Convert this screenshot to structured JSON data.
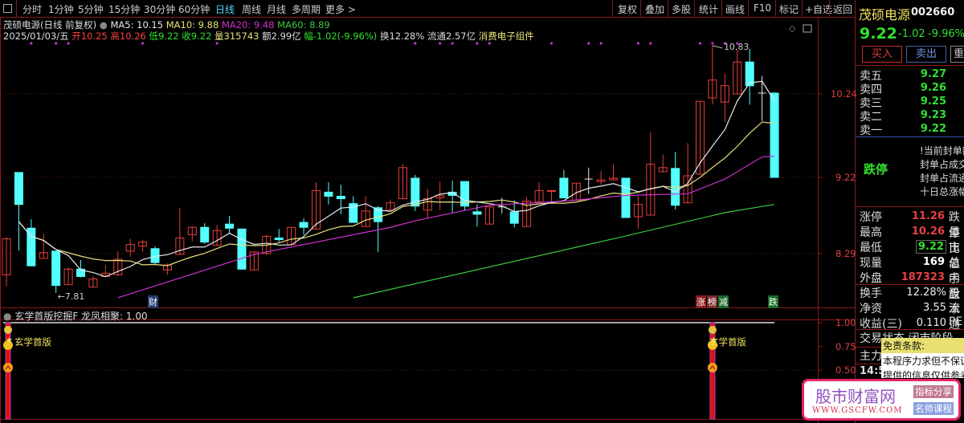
{
  "toolbar": {
    "left": [
      "分时",
      "1分钟",
      "5分钟",
      "15分钟",
      "30分钟",
      "60分钟",
      "日线",
      "周线",
      "月线",
      "多周期",
      "更多 >"
    ],
    "active": "日线",
    "right": [
      "复权",
      "叠加",
      "多股",
      "统计",
      "画线",
      "F10",
      "标记",
      "+自选",
      "返回"
    ]
  },
  "info": {
    "name": "茂硕电源(日线 前复权)",
    "ma5": "MA5: 10.15",
    "ma10": "MA10: 9.88",
    "ma20": "MA20: 9.48",
    "ma60": "MA60: 8.89",
    "date": "2025/01/03/五",
    "open": "开10.25",
    "high": "高10.26",
    "low": "低9.22",
    "close": "收9.22",
    "vol": "量315743",
    "amount": "额2.99亿",
    "change": "幅-1.02(-9.96%)",
    "turnover": "换12.28%",
    "float": "流通2.57亿",
    "sector": "消费电子组件"
  },
  "axis": {
    "main": [
      "10.24",
      "9.22",
      "8.29"
    ],
    "sub": [
      "1.00",
      "0.75",
      "0.50"
    ]
  },
  "chart_tags": {
    "cai": "财",
    "zhang": "涨",
    "bang": "榜",
    "jian": "减",
    "die": "跌"
  },
  "sub_panel": {
    "title": "玄学首版挖掘F",
    "param": "龙凤相聚: 1.00",
    "signal_label": "玄学首版"
  },
  "chart_data": {
    "type": "candlestick",
    "ylim": [
      7.7,
      10.9
    ],
    "candles_ohlc": [
      [
        8.03,
        8.49,
        7.89,
        8.47
      ],
      [
        9.28,
        9.28,
        8.33,
        8.89
      ],
      [
        8.6,
        8.71,
        8.14,
        8.14
      ],
      [
        8.23,
        8.53,
        8.23,
        8.3
      ],
      [
        8.32,
        8.32,
        7.81,
        7.9
      ],
      [
        7.91,
        8.12,
        7.91,
        8.1
      ],
      [
        8.1,
        8.21,
        8.0,
        8.01
      ],
      [
        7.88,
        8.01,
        7.88,
        7.98
      ],
      [
        8.01,
        8.15,
        8.0,
        8.05
      ],
      [
        8.03,
        8.32,
        8.02,
        8.22
      ],
      [
        8.32,
        8.47,
        8.25,
        8.4
      ],
      [
        8.38,
        8.46,
        8.31,
        8.43
      ],
      [
        8.35,
        8.38,
        8.15,
        8.18
      ],
      [
        8.09,
        8.17,
        8.03,
        8.15
      ],
      [
        8.28,
        8.85,
        8.28,
        8.48
      ],
      [
        8.52,
        8.62,
        8.44,
        8.61
      ],
      [
        8.61,
        8.66,
        8.41,
        8.43
      ],
      [
        8.39,
        8.64,
        8.39,
        8.57
      ],
      [
        8.65,
        8.75,
        8.53,
        8.6
      ],
      [
        8.59,
        8.59,
        8.1,
        8.1
      ],
      [
        8.09,
        8.31,
        8.09,
        8.31
      ],
      [
        8.29,
        8.52,
        8.27,
        8.5
      ],
      [
        8.48,
        8.59,
        8.43,
        8.46
      ],
      [
        8.4,
        8.61,
        8.4,
        8.61
      ],
      [
        8.67,
        8.72,
        8.52,
        8.61
      ],
      [
        8.59,
        9.16,
        8.59,
        9.06
      ],
      [
        9.04,
        9.16,
        8.89,
        8.99
      ],
      [
        8.99,
        9.13,
        8.77,
        8.96
      ],
      [
        8.9,
        8.99,
        8.67,
        8.67
      ],
      [
        8.62,
        8.99,
        8.62,
        8.81
      ],
      [
        8.85,
        8.87,
        8.31,
        8.68
      ],
      [
        8.82,
        8.95,
        8.8,
        8.91
      ],
      [
        8.96,
        9.38,
        8.96,
        9.34
      ],
      [
        9.21,
        9.25,
        8.81,
        8.87
      ],
      [
        8.82,
        9.08,
        8.72,
        8.96
      ],
      [
        8.97,
        9.17,
        8.82,
        9.0
      ],
      [
        9.04,
        9.18,
        8.78,
        9.0
      ],
      [
        9.17,
        9.17,
        8.82,
        8.87
      ],
      [
        8.8,
        8.89,
        8.62,
        8.77
      ],
      [
        8.65,
        8.86,
        8.65,
        8.86
      ],
      [
        8.86,
        8.97,
        8.78,
        8.86
      ],
      [
        8.8,
        8.94,
        8.61,
        8.66
      ],
      [
        8.62,
        8.98,
        8.62,
        8.93
      ],
      [
        8.92,
        9.16,
        8.92,
        9.06
      ],
      [
        9.05,
        9.06,
        8.92,
        9.06
      ],
      [
        9.21,
        9.31,
        8.97,
        8.97
      ],
      [
        8.94,
        9.15,
        8.94,
        9.15
      ],
      [
        9.2,
        9.34,
        9.02,
        9.2
      ],
      [
        9.17,
        9.3,
        9.13,
        9.19
      ],
      [
        9.19,
        9.38,
        9.19,
        9.21
      ],
      [
        9.21,
        9.21,
        8.73,
        8.73
      ],
      [
        8.74,
        8.99,
        8.59,
        8.89
      ],
      [
        8.76,
        9.77,
        8.76,
        9.38
      ],
      [
        9.29,
        9.5,
        9.28,
        9.34
      ],
      [
        9.33,
        9.53,
        8.83,
        8.88
      ],
      [
        8.91,
        9.64,
        8.91,
        9.24
      ],
      [
        9.26,
        10.15,
        9.26,
        10.15
      ],
      [
        10.19,
        10.83,
        10.11,
        10.41
      ],
      [
        10.14,
        10.49,
        9.9,
        10.34
      ],
      [
        10.24,
        10.78,
        10.24,
        10.63
      ],
      [
        10.63,
        10.79,
        10.11,
        10.34
      ],
      [
        10.25,
        10.46,
        9.91,
        10.25
      ],
      [
        10.25,
        10.26,
        9.22,
        9.22
      ]
    ],
    "ma20_points": [
      [
        9,
        7.75
      ],
      [
        20,
        8.28
      ],
      [
        31,
        8.61
      ],
      [
        33,
        8.69
      ],
      [
        39,
        8.88
      ],
      [
        45,
        8.93
      ],
      [
        50,
        9.0
      ],
      [
        55,
        9.02
      ],
      [
        58,
        9.2
      ],
      [
        61,
        9.47
      ],
      [
        62,
        9.48
      ]
    ],
    "ma60_points": [
      [
        28,
        7.75
      ],
      [
        49,
        8.47
      ],
      [
        58,
        8.79
      ],
      [
        62,
        8.89
      ]
    ],
    "signal_dot_indices": [
      2,
      4,
      5,
      11,
      17,
      33,
      35,
      36,
      38,
      39,
      44,
      47,
      48,
      51,
      52,
      56,
      57,
      58,
      59
    ],
    "low_label": "7.81",
    "high_label": "10.83",
    "sub_signal_indices": [
      0,
      57
    ],
    "sub_value": 1.0,
    "colors": {
      "up": "#e2403a",
      "down": "#54ffff",
      "ma5": "#e8e8e8",
      "ma10": "#e6e07a",
      "ma20": "#d030d0",
      "ma60": "#3cc83c"
    }
  },
  "quote": {
    "name": "茂硕电源",
    "code": "002660",
    "price": "9.22",
    "change": "-1.02",
    "pct": "-9.96%",
    "buy": "买入",
    "sell": "卖出",
    "more": "重",
    "asks": [
      {
        "label": "卖五",
        "price": "9.27"
      },
      {
        "label": "卖四",
        "price": "9.26"
      },
      {
        "label": "卖三",
        "price": "9.25"
      },
      {
        "label": "卖二",
        "price": "9.23"
      },
      {
        "label": "卖一",
        "price": "9.22"
      }
    ],
    "limit_status": "跌停",
    "limit_info": [
      "!当前封单额",
      "封单占成交",
      "封单占流通",
      "十日总涨幅"
    ],
    "stats": [
      {
        "label": "涨停",
        "value": "11.26",
        "right": "跌停",
        "color": "#e84040"
      },
      {
        "label": "最高",
        "value": "10.26",
        "right": "量比",
        "color": "#e84040"
      },
      {
        "label": "最低",
        "value": "9.22",
        "right": "市值",
        "color": "#30e030"
      },
      {
        "label": "现量",
        "value": "169",
        "right": "总手",
        "color": "#ffffff"
      },
      {
        "label": "外盘",
        "value": "187323",
        "right": "内盘",
        "color": "#e84040"
      }
    ],
    "stats2": [
      {
        "label": "换手",
        "value": "12.28%",
        "right": "股本"
      },
      {
        "label": "净资",
        "value": "3.55",
        "right": "流通"
      },
      {
        "label": "收益(三)",
        "value": "0.110",
        "right": "PE"
      }
    ],
    "trade_status": "交易状态 闭市阶段",
    "main_force": "主力",
    "time": "14:5"
  },
  "tooltip": {
    "title": "免责条款:",
    "lines": [
      "本程序力求但不保证",
      "提供的信息仅供参考"
    ]
  },
  "watermark": {
    "name": "股市财富网",
    "url": "WWW.GSCFW.COM",
    "tag1": "指标分享",
    "tag2": "名师课程"
  }
}
